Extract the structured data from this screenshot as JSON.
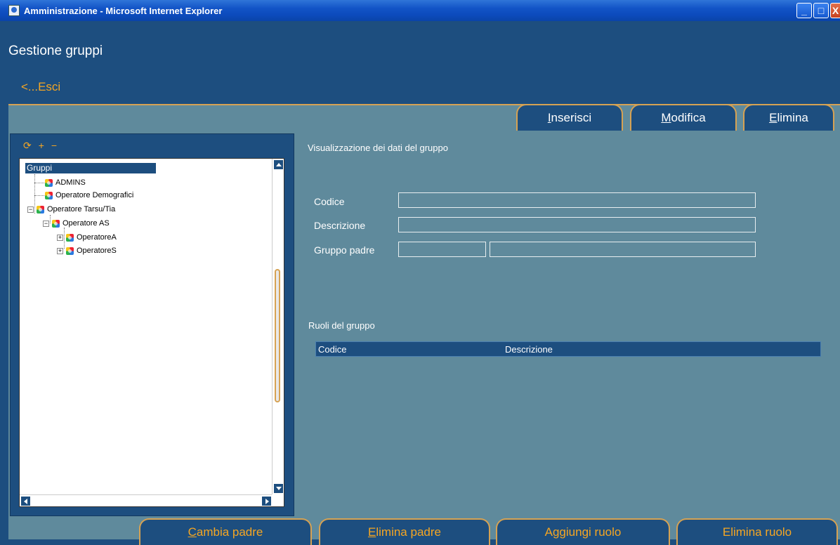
{
  "window": {
    "title": "Amministrazione - Microsoft Internet Explorer",
    "minimize": "_",
    "maximize": "□",
    "close": "X"
  },
  "header": {
    "page_title": "Gestione gruppi",
    "exit_link": "<...Esci"
  },
  "top_tabs": [
    {
      "accel": "I",
      "rest": "nserisci"
    },
    {
      "accel": "M",
      "rest": "odifica"
    },
    {
      "accel": "E",
      "rest": "limina"
    }
  ],
  "tree": {
    "toolbar_icons": [
      "refresh-icon",
      "expand-icon",
      "collapse-icon"
    ],
    "root": "Gruppi",
    "nodes": [
      {
        "label": "ADMINS"
      },
      {
        "label": "Operatore Demografici"
      },
      {
        "label": "Operatore Tarsu/Tia"
      },
      {
        "label": "Operatore AS"
      },
      {
        "label": "OperatoreA"
      },
      {
        "label": "OperatoreS"
      }
    ]
  },
  "form": {
    "section_title": "Visualizzazione dei dati del gruppo",
    "codice_label": "Codice",
    "descrizione_label": "Descrizione",
    "gruppo_padre_label": "Gruppo padre",
    "codice_value": "",
    "descrizione_value": "",
    "gruppo_padre_code": "",
    "gruppo_padre_desc": ""
  },
  "roles": {
    "title": "Ruoli del gruppo",
    "columns": [
      "Codice",
      "Descrizione"
    ]
  },
  "bottom_tabs": [
    {
      "accel": "C",
      "rest": "ambia padre"
    },
    {
      "accel": "E",
      "rest": "limina padre"
    },
    {
      "accel": "",
      "rest": "Aggiungi ruolo"
    },
    {
      "accel": "",
      "rest": "Elimina ruolo"
    }
  ],
  "colors": {
    "background": "#1d4e7f",
    "panel": "#5f8a9c",
    "accent": "#f5a623",
    "tab_border": "#d6a253"
  }
}
